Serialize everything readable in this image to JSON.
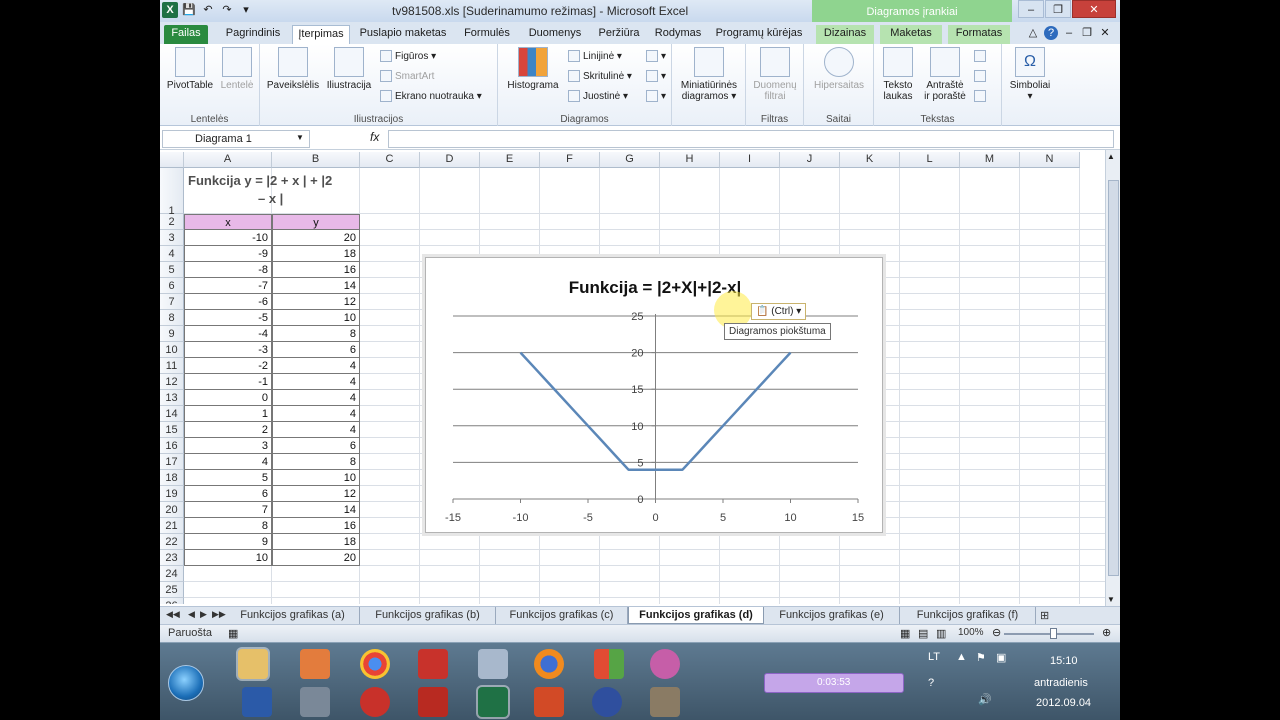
{
  "window": {
    "title": "tv981508.xls  [Suderinamumo režimas]  -  Microsoft Excel",
    "context_header": "Diagramos įrankiai"
  },
  "tabs": [
    {
      "label": "Failas"
    },
    {
      "label": "Pagrindinis"
    },
    {
      "label": "Įterpimas"
    },
    {
      "label": "Puslapio maketas"
    },
    {
      "label": "Formulės"
    },
    {
      "label": "Duomenys"
    },
    {
      "label": "Peržiūra"
    },
    {
      "label": "Rodymas"
    },
    {
      "label": "Programų kūrėjas"
    },
    {
      "label": "Dizainas"
    },
    {
      "label": "Maketas"
    },
    {
      "label": "Formatas"
    }
  ],
  "ribbon": {
    "groups": {
      "lenteles": "Lentelės",
      "iliustracijos": "Iliustracijos",
      "diagramos": "Diagramos",
      "filtras": "Filtras",
      "saitai": "Saitai",
      "tekstas": "Tekstas"
    },
    "buttons": {
      "pivot": "PivotTable",
      "lentele": "Lentelė",
      "paveikslelis": "Paveikslėlis",
      "iliustracija": "Iliustracija",
      "figuros": "Figūros",
      "smartart": "SmartArt",
      "ekrano": "Ekrano nuotrauka",
      "histograma": "Histograma",
      "linijine": "Linijinė",
      "skrituline": "Skritulinė",
      "juostine": "Juostinė",
      "mini1": "Miniatiūrinės",
      "mini2": "diagramos",
      "duom1": "Duomenų",
      "duom2": "filtrai",
      "hipersaitas": "Hipersaitas",
      "teksto1": "Teksto",
      "teksto2": "laukas",
      "antraste1": "Antraštė",
      "antraste2": "ir poraštė",
      "simboliai": "Simboliai"
    }
  },
  "formula_bar": {
    "name_box": "Diagrama 1",
    "fx": "fx",
    "formula": ""
  },
  "sheet": {
    "columns": [
      "A",
      "B",
      "C",
      "D",
      "E",
      "F",
      "G",
      "H",
      "I",
      "J",
      "K",
      "L",
      "M",
      "N"
    ],
    "rows": [
      "1",
      "2",
      "3",
      "4",
      "5",
      "6",
      "7",
      "8",
      "9",
      "10",
      "11",
      "12",
      "13",
      "14",
      "15",
      "16",
      "17",
      "18",
      "19",
      "20",
      "21",
      "22",
      "23",
      "24",
      "25",
      "26"
    ],
    "a1_line1": "Funkcija  y  = |2 + x | + |2",
    "a1_line2": "– x |",
    "header_x": "x",
    "header_y": "y",
    "x_values": [
      "-10",
      "-9",
      "-8",
      "-7",
      "-6",
      "-5",
      "-4",
      "-3",
      "-2",
      "-1",
      "0",
      "1",
      "2",
      "3",
      "4",
      "5",
      "6",
      "7",
      "8",
      "9",
      "10"
    ],
    "y_values": [
      "20",
      "18",
      "16",
      "14",
      "12",
      "10",
      "8",
      "6",
      "4",
      "4",
      "4",
      "4",
      "4",
      "6",
      "8",
      "10",
      "12",
      "14",
      "16",
      "18",
      "20"
    ]
  },
  "chart_data": {
    "type": "scatter",
    "title": "Funkcija = |2+X|+|2-x|",
    "x": [
      -10,
      -9,
      -8,
      -7,
      -6,
      -5,
      -4,
      -3,
      -2,
      -1,
      0,
      1,
      2,
      3,
      4,
      5,
      6,
      7,
      8,
      9,
      10
    ],
    "series": [
      {
        "values": [
          20,
          18,
          16,
          14,
          12,
          10,
          8,
          6,
          4,
          4,
          4,
          4,
          4,
          6,
          8,
          10,
          12,
          14,
          16,
          18,
          20
        ],
        "color": "#5b87b8"
      }
    ],
    "xlim": [
      -15,
      15
    ],
    "ylim": [
      0,
      25
    ],
    "x_ticks": [
      "-15",
      "-10",
      "-5",
      "0",
      "5",
      "10",
      "15"
    ],
    "y_ticks": [
      "0",
      "5",
      "10",
      "15",
      "20",
      "25"
    ],
    "grid": true,
    "line_style": "smooth-lines-no-markers"
  },
  "chart_ui": {
    "paste_options": "(Ctrl)",
    "tooltip": "Diagramos piokštuma"
  },
  "sheet_tabs": [
    {
      "label": "Funkcijos grafikas (a)"
    },
    {
      "label": "Funkcijos grafikas (b)"
    },
    {
      "label": "Funkcijos grafikas (c)"
    },
    {
      "label": "Funkcijos grafikas (d)"
    },
    {
      "label": "Funkcijos grafikas (e)"
    },
    {
      "label": "Funkcijos grafikas (f)"
    }
  ],
  "status": {
    "ready": "Paruošta",
    "zoom": "100%"
  },
  "taskbar": {
    "lang": "LT",
    "time": "15:10",
    "day": "antradienis",
    "date": "2012.09.04",
    "media_time": "0:03:53"
  }
}
